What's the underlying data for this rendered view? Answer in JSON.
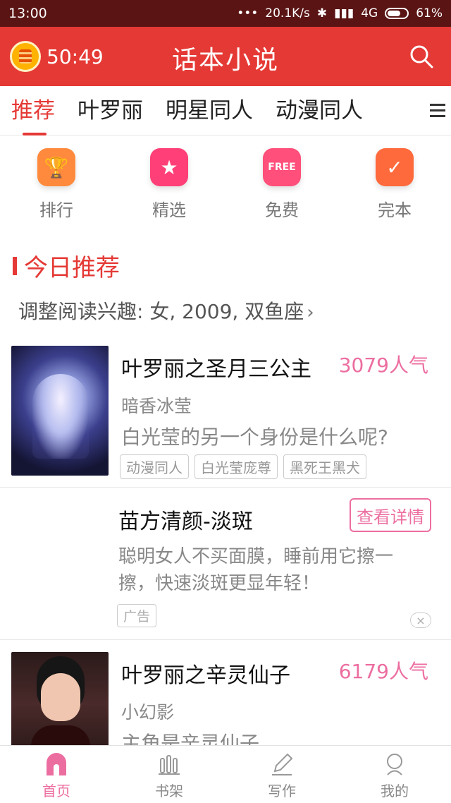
{
  "status_bar": {
    "time": "13:00",
    "dots": "•••",
    "network_speed": "20.1K/s",
    "signal": "4G",
    "battery": "61%"
  },
  "header": {
    "timer": "50:49",
    "title": "话本小说"
  },
  "tabs": [
    {
      "label": "推荐"
    },
    {
      "label": "叶罗丽"
    },
    {
      "label": "明星同人"
    },
    {
      "label": "动漫同人"
    }
  ],
  "categories": [
    {
      "label": "排行",
      "color": "#ff8a3d"
    },
    {
      "label": "精选",
      "color": "#ff3f77"
    },
    {
      "label": "免费",
      "color": "#ff4f7a",
      "badge": "FREE"
    },
    {
      "label": "完本",
      "color": "#ff6a3d"
    }
  ],
  "section": {
    "title": "今日推荐",
    "interest": "调整阅读兴趣: 女, 2009, 双鱼座"
  },
  "books": [
    {
      "title": "叶罗丽之圣月三公主",
      "popularity": "3079人气",
      "author": "暗香冰莹",
      "desc": "白光莹的另一个身份是什么呢?",
      "tags": [
        "动漫同人",
        "白光莹庞尊",
        "黑死王黑犬"
      ]
    },
    {
      "title": "叶罗丽之辛灵仙子",
      "popularity": "6179人气",
      "author": "小幻影",
      "desc": "主角是辛灵仙子"
    }
  ],
  "ad": {
    "title": "苗方清颜-淡斑",
    "button": "查看详情",
    "desc": "聪明女人不买面膜，睡前用它擦一擦，快速淡斑更显年轻！",
    "badge": "广告",
    "close": "×"
  },
  "bottom_nav": [
    {
      "label": "首页"
    },
    {
      "label": "书架"
    },
    {
      "label": "写作"
    },
    {
      "label": "我的"
    }
  ],
  "colors": {
    "accent": "#e53935",
    "pink": "#ec6ea0"
  }
}
